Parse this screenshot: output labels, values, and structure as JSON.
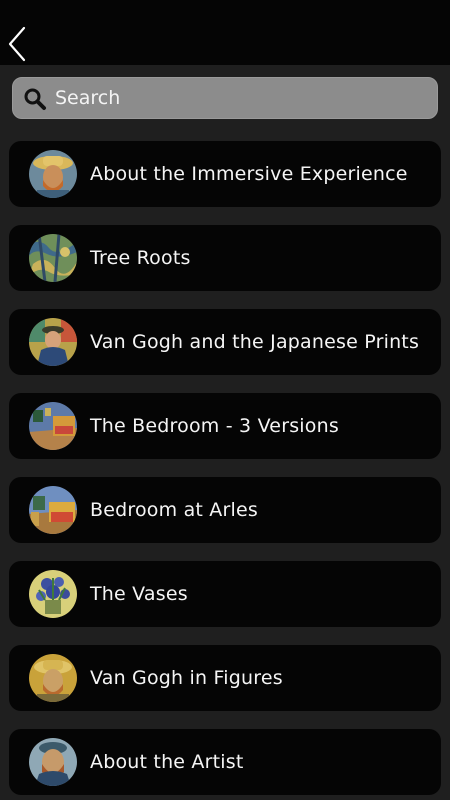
{
  "nav": {
    "back_icon": "chevron-left-icon"
  },
  "search": {
    "placeholder": "Search",
    "value": "",
    "icon": "search-icon"
  },
  "items": [
    {
      "label": "About the Immersive Experience",
      "thumb": "van-gogh-self-portrait-straw-hat"
    },
    {
      "label": "Tree Roots",
      "thumb": "tree-roots-painting"
    },
    {
      "label": "Van Gogh and the Japanese Prints",
      "thumb": "portrait-pere-tanguy"
    },
    {
      "label": "The Bedroom - 3 Versions",
      "thumb": "bedroom-painting"
    },
    {
      "label": "Bedroom at Arles",
      "thumb": "bedroom-at-arles-painting"
    },
    {
      "label": "The Vases",
      "thumb": "irises-vase-painting"
    },
    {
      "label": "Van Gogh in Figures",
      "thumb": "van-gogh-self-portrait-straw-hat"
    },
    {
      "label": "About the Artist",
      "thumb": "van-gogh-self-portrait"
    }
  ]
}
